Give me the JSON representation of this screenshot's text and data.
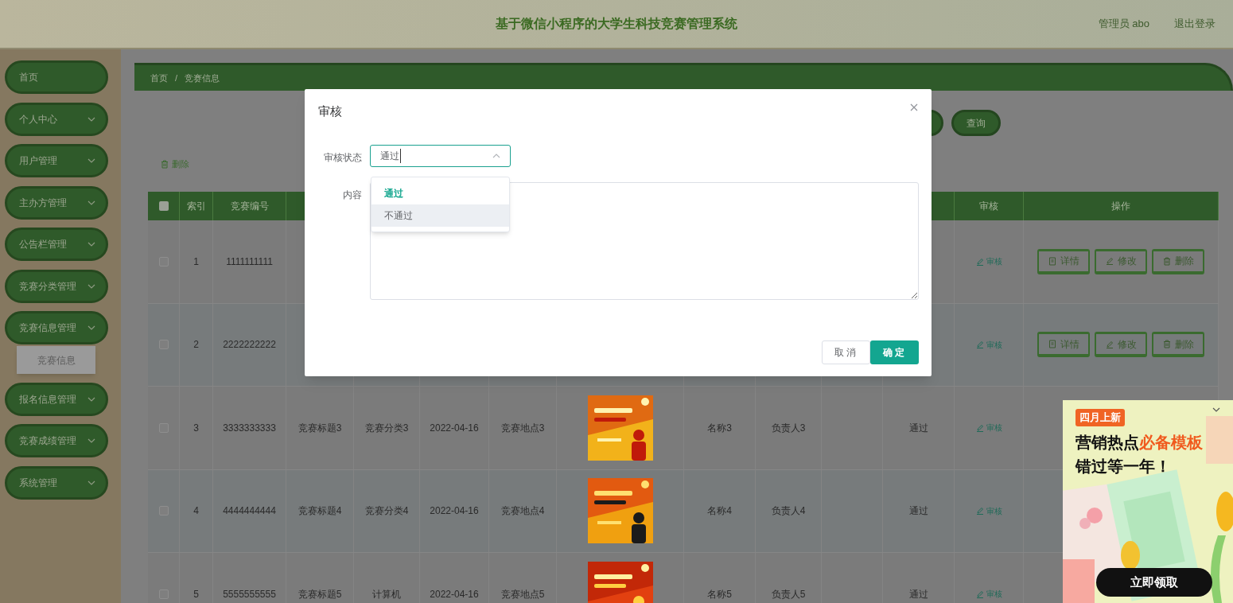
{
  "header": {
    "title": "基于微信小程序的大学生科技竞赛管理系统",
    "user": "管理员 abo",
    "logout": "退出登录"
  },
  "sidebar": {
    "items": [
      {
        "kind": "link",
        "label": "首页"
      },
      {
        "kind": "menu",
        "label": "个人中心"
      },
      {
        "kind": "menu",
        "label": "用户管理"
      },
      {
        "kind": "menu",
        "label": "主办方管理"
      },
      {
        "kind": "menu",
        "label": "公告栏管理"
      },
      {
        "kind": "menu",
        "label": "竞赛分类管理"
      },
      {
        "kind": "menu",
        "label": "竞赛信息管理",
        "children": [
          {
            "label": "竞赛信息",
            "selected": true
          }
        ]
      },
      {
        "kind": "menu",
        "label": "报名信息管理"
      },
      {
        "kind": "menu",
        "label": "竞赛成绩管理"
      },
      {
        "kind": "menu",
        "label": "系统管理"
      }
    ]
  },
  "breadcrumb": {
    "items": [
      "首页",
      "竞赛信息"
    ],
    "separator": "/"
  },
  "search": {
    "query_button": "查询"
  },
  "toolbar": {
    "delete_button": "删除"
  },
  "table": {
    "select_all": {
      "checked": false
    },
    "columns": [
      "索引",
      "竞赛编号",
      "审核",
      "操作"
    ],
    "rows": [
      {
        "checked": false,
        "index": "1",
        "number": "1111111111",
        "audit": "审核",
        "actions": [
          "详情",
          "修改",
          "删除"
        ]
      },
      {
        "checked": false,
        "index": "2",
        "number": "2222222222",
        "audit": "审核",
        "actions": [
          "详情",
          "修改",
          "删除"
        ]
      },
      {
        "checked": false,
        "index": "3",
        "number": "3333333333",
        "title": "竞赛标题3",
        "category": "竞赛分类3",
        "date": "2022-04-16",
        "location": "竞赛地点3",
        "name": "名称3",
        "manager": "负责人3",
        "status": "通过",
        "audit": "审核"
      },
      {
        "checked": false,
        "index": "4",
        "number": "4444444444",
        "title": "竞赛标题4",
        "category": "竞赛分类4",
        "date": "2022-04-16",
        "location": "竞赛地点4",
        "name": "名称4",
        "manager": "负责人4",
        "status": "通过",
        "audit": "审核"
      },
      {
        "checked": false,
        "index": "5",
        "number": "5555555555",
        "title": "竞赛标题5",
        "category": "计算机",
        "date": "2022-04-16",
        "location": "竞赛地点5",
        "name": "名称5",
        "manager": "负责人5",
        "status": "通过",
        "audit": "审核"
      }
    ]
  },
  "dialog": {
    "title": "审核",
    "fields": [
      {
        "kind": "select",
        "label": "审核状态",
        "value": "通过",
        "open": true,
        "options": [
          {
            "label": "通过",
            "selected": true,
            "hovered": false
          },
          {
            "label": "不通过",
            "selected": false,
            "hovered": true
          }
        ]
      },
      {
        "kind": "textarea",
        "label": "内容"
      }
    ],
    "buttons": [
      {
        "label": "取消",
        "primary": false
      },
      {
        "label": "确定",
        "primary": true
      }
    ]
  },
  "ad": {
    "tag": "四月上新",
    "headline": [
      {
        "text": "营销热点",
        "accent": false
      },
      {
        "text": "必备模板",
        "accent": true
      }
    ],
    "subline": "错过等一年！",
    "button": "立即领取"
  }
}
